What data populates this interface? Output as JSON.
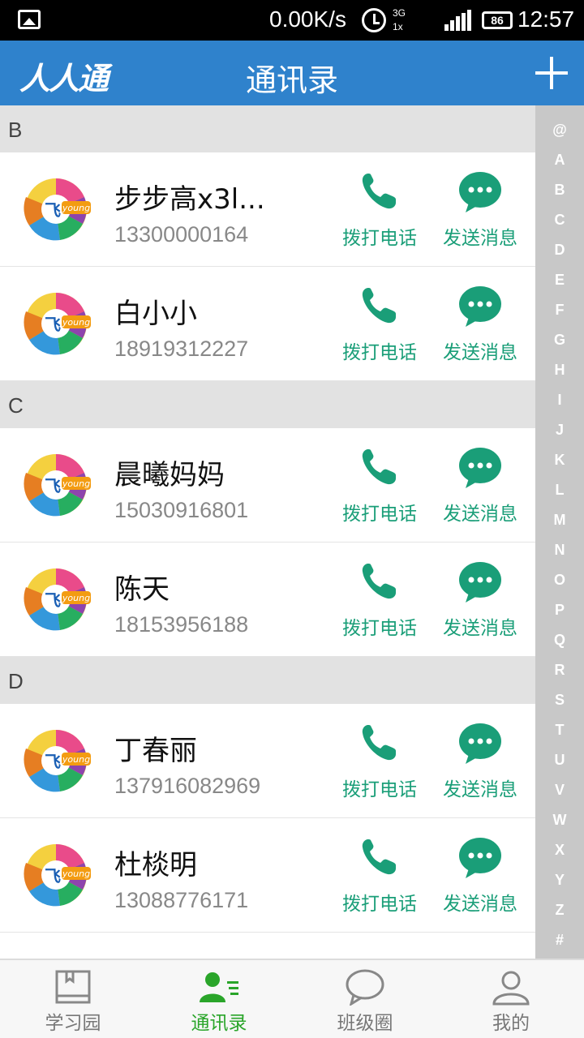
{
  "status_bar": {
    "speed": "0.00K/s",
    "network_top": "3G",
    "network_bottom": "1x",
    "battery": "86",
    "time": "12:57"
  },
  "app_bar": {
    "logo": "人人通",
    "title": "通讯录"
  },
  "contacts": {
    "call_label": "拨打电话",
    "message_label": "发送消息",
    "sections": [
      {
        "letter": "B",
        "items": [
          {
            "name": "步步高x3l...",
            "phone": "13300000164"
          },
          {
            "name": "白小小",
            "phone": "18919312227"
          }
        ]
      },
      {
        "letter": "C",
        "items": [
          {
            "name": "晨曦妈妈",
            "phone": "15030916801"
          },
          {
            "name": "陈天",
            "phone": "18153956188"
          }
        ]
      },
      {
        "letter": "D",
        "items": [
          {
            "name": "丁春丽",
            "phone": "137916082969"
          },
          {
            "name": "杜棪明",
            "phone": "13088776171"
          }
        ]
      }
    ]
  },
  "index_letters": [
    "@",
    "A",
    "B",
    "C",
    "D",
    "E",
    "F",
    "G",
    "H",
    "I",
    "J",
    "K",
    "L",
    "M",
    "N",
    "O",
    "P",
    "Q",
    "R",
    "S",
    "T",
    "U",
    "V",
    "W",
    "X",
    "Y",
    "Z",
    "#"
  ],
  "tabs": [
    {
      "label": "学习园",
      "icon": "book-icon",
      "active": false
    },
    {
      "label": "通讯录",
      "icon": "contacts-icon",
      "active": true
    },
    {
      "label": "班级圈",
      "icon": "chat-bubble-icon",
      "active": false
    },
    {
      "label": "我的",
      "icon": "person-icon",
      "active": false
    }
  ],
  "colors": {
    "app_bar": "#2f82cc",
    "action_green": "#1a9e78",
    "active_tab": "#2aa52a",
    "section_header": "#e2e2e2",
    "index_bar": "#c8c8c8"
  }
}
